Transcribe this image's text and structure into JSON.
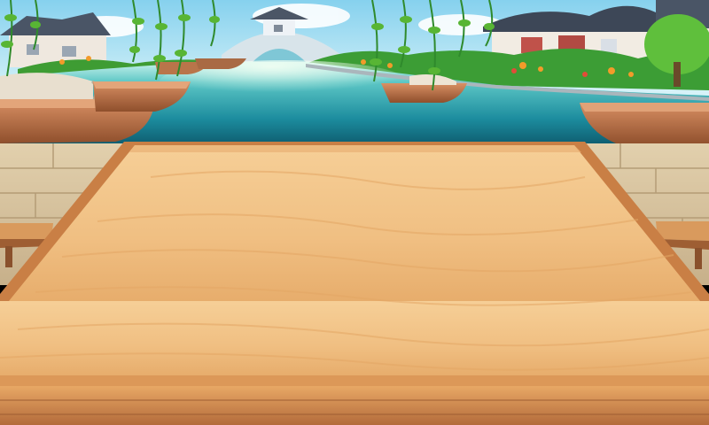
{
  "scene": {
    "type": "game-background",
    "setting": "canal-town",
    "palette": {
      "sky_top": "#8fd6ef",
      "sky_bottom": "#d9f4f8",
      "water_dark": "#0d5f73",
      "water_mid": "#1e9aa8",
      "water_light": "#b9efe6",
      "stone": "#d5c2a0",
      "wood_table": "#f1c489",
      "wood_edge": "#d18e4f",
      "wood_dark": "#a8643a",
      "foliage": "#3fa536",
      "foliage_light": "#7ad04a",
      "roof": "#3f4a5b",
      "wall": "#f1ece3",
      "boat": "#c77c49"
    },
    "elements": [
      "sky",
      "stone-bridge",
      "far-houses-left",
      "houses-right",
      "willow-branches",
      "canal-water",
      "boats",
      "stone-pavement",
      "wooden-table-top",
      "benches"
    ]
  }
}
